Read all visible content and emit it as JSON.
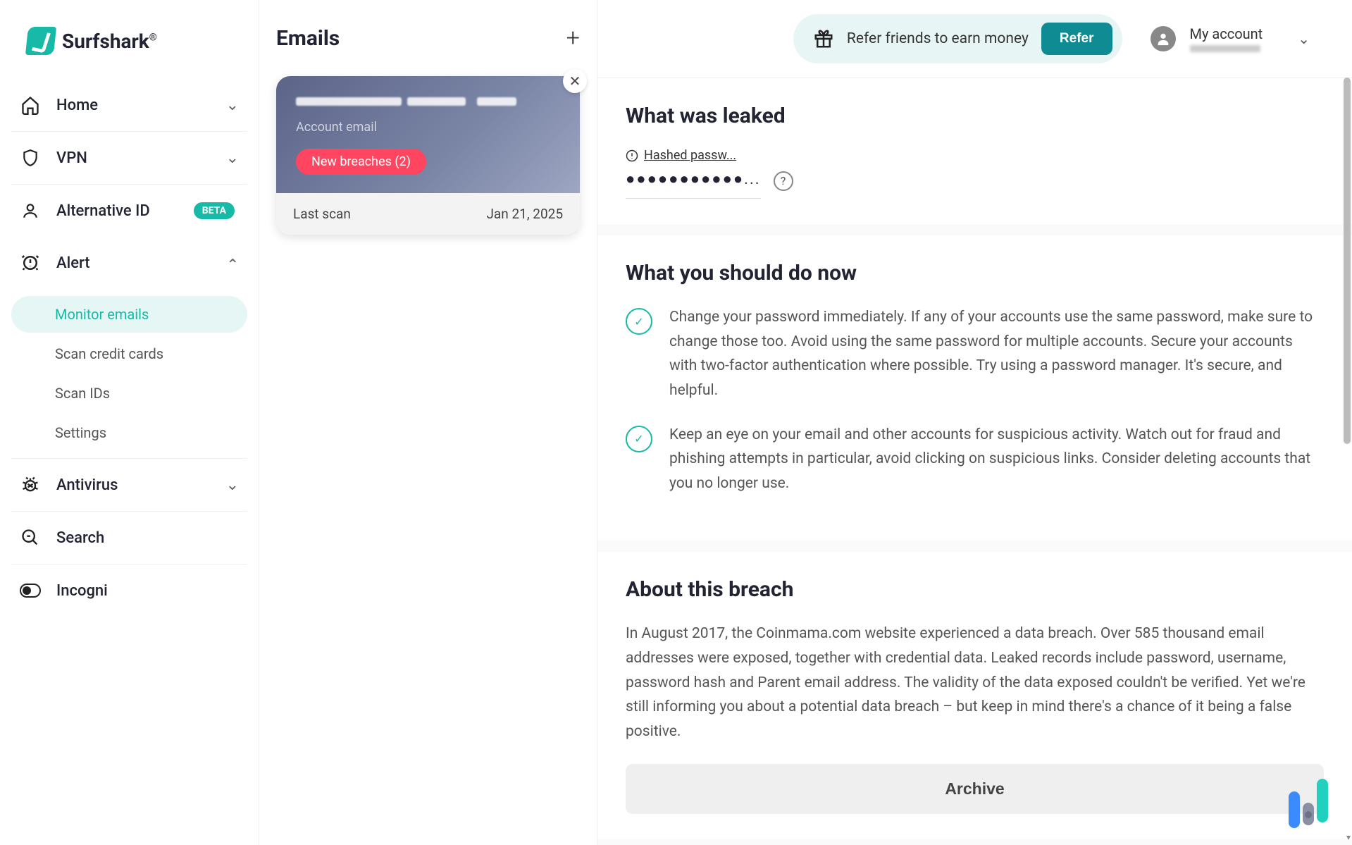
{
  "brand": "Surfshark",
  "nav": {
    "home": "Home",
    "vpn": "VPN",
    "altid": "Alternative ID",
    "altid_badge": "BETA",
    "alert": "Alert",
    "antivirus": "Antivirus",
    "search": "Search",
    "incogni": "Incogni",
    "sub": {
      "monitor": "Monitor emails",
      "cards": "Scan credit cards",
      "ids": "Scan IDs",
      "settings": "Settings"
    }
  },
  "mid": {
    "title": "Emails",
    "card": {
      "account_label": "Account email",
      "breach_label": "New breaches (2)",
      "last_scan_label": "Last scan",
      "last_scan_date": "Jan 21, 2025"
    }
  },
  "topbar": {
    "refer_text": "Refer friends to earn money",
    "refer_btn": "Refer",
    "account_label": "My account"
  },
  "content": {
    "leaked_title": "What was leaked",
    "leaked_item": "Hashed passw...",
    "leaked_dots": "●●●●●●●●●●●...",
    "todo_title": "What you should do now",
    "advice1": "Change your password immediately. If any of your accounts use the same password, make sure to change those too. Avoid using the same password for multiple accounts. Secure your accounts with two-factor authentication where possible. Try using a password manager. It's secure, and helpful.",
    "advice2": "Keep an eye on your email and other accounts for suspicious activity. Watch out for fraud and phishing attempts in particular, avoid clicking on suspicious links. Consider deleting accounts that you no longer use.",
    "about_title": "About this breach",
    "about_text": "In August 2017, the Coinmama.com website experienced a data breach. Over 585 thousand email addresses were exposed, together with credential data. Leaked records include password, username, password hash and Parent email address. The validity of the data exposed couldn't be verified. Yet we're still informing you about a potential data breach – but keep in mind there's a chance of it being a false positive.",
    "archive_btn": "Archive"
  }
}
